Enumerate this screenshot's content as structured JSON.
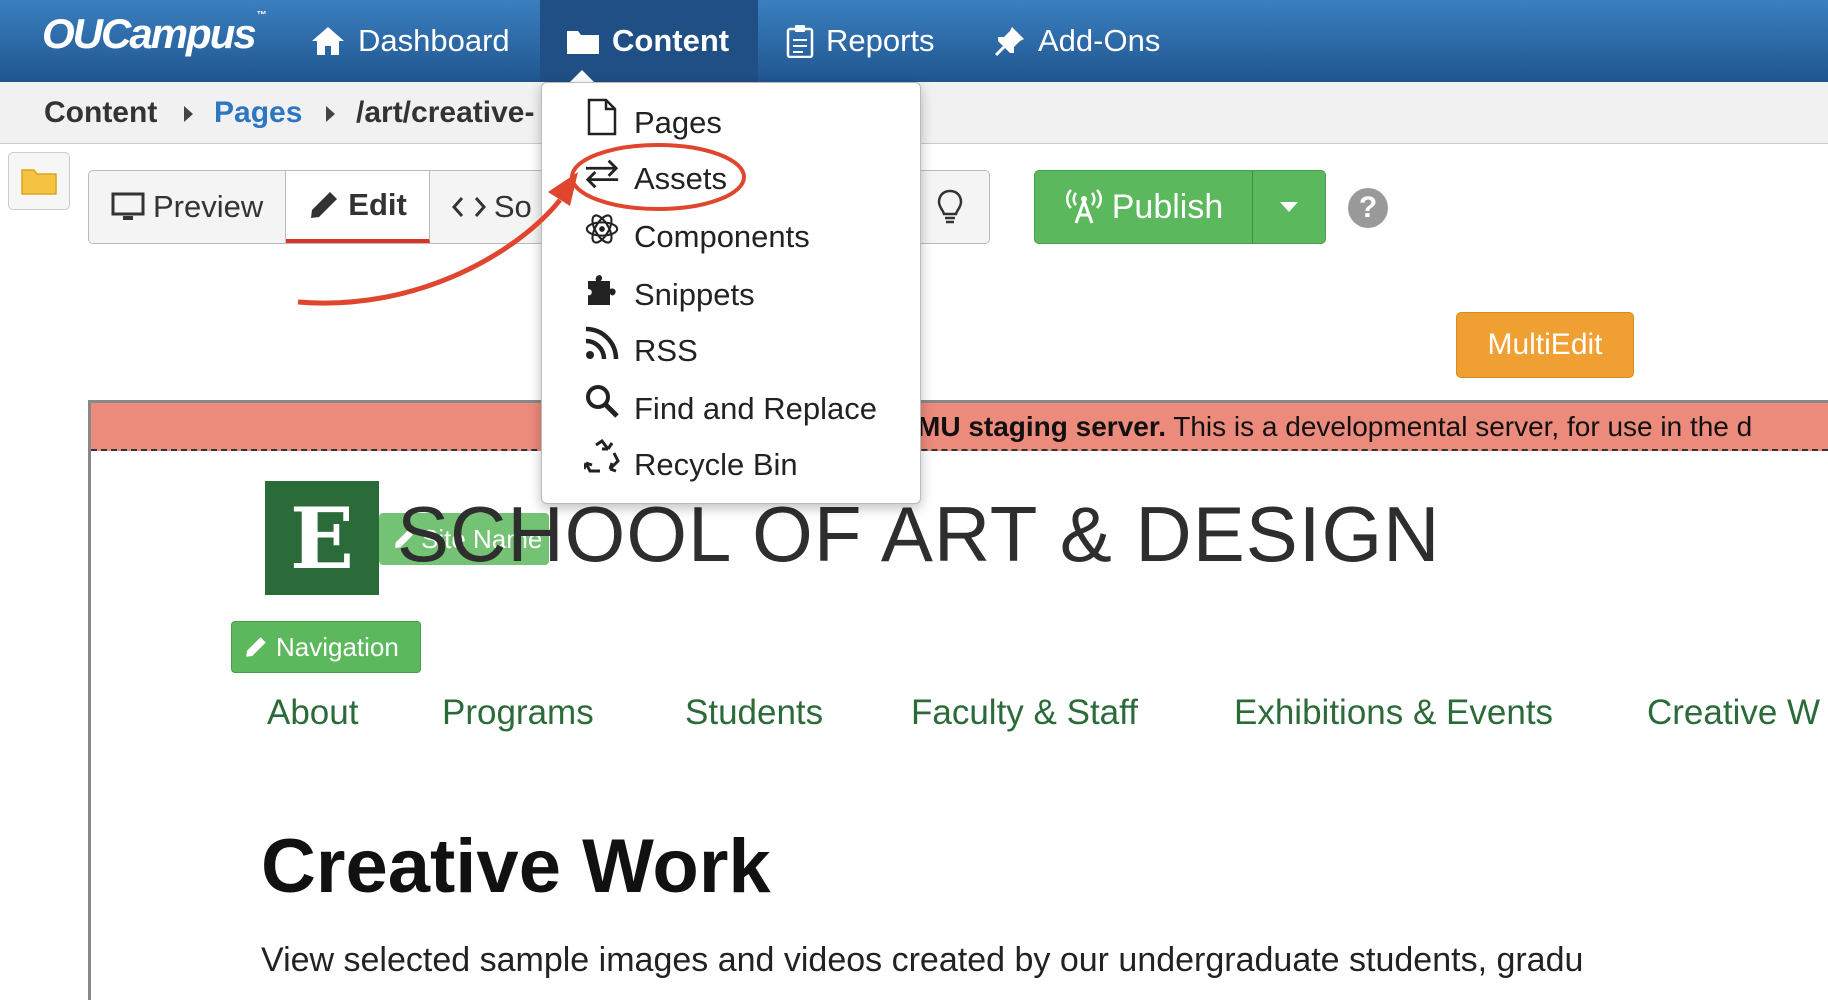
{
  "app": {
    "logo": "OUCampus",
    "logo_tm": "™"
  },
  "topnav": {
    "items": [
      {
        "label": "Dashboard",
        "icon": "home-icon"
      },
      {
        "label": "Content",
        "icon": "folder-icon",
        "active": true
      },
      {
        "label": "Reports",
        "icon": "clipboard-icon"
      },
      {
        "label": "Add-Ons",
        "icon": "pin-icon"
      }
    ]
  },
  "breadcrumb": {
    "items": [
      "Content",
      "Pages",
      "/art/creative-"
    ]
  },
  "toolbar": {
    "preview": "Preview",
    "edit": "Edit",
    "source": "So",
    "publish": "Publish",
    "help": "?",
    "multiedit": "MultiEdit"
  },
  "dropdown": {
    "items": [
      {
        "label": "Pages",
        "icon": "page-icon"
      },
      {
        "label": "Assets",
        "icon": "exchange-icon",
        "highlighted": true
      },
      {
        "label": "Components",
        "icon": "atom-icon"
      },
      {
        "label": "Snippets",
        "icon": "puzzle-icon"
      },
      {
        "label": "RSS",
        "icon": "rss-icon"
      },
      {
        "label": "Find and Replace",
        "icon": "search-icon"
      },
      {
        "label": "Recycle Bin",
        "icon": "recycle-icon"
      }
    ]
  },
  "preview": {
    "staging_bold": "MU staging server.",
    "staging_text": " This is a developmental server, for use in the d",
    "logo_letter": "E",
    "site_name_button": "Site Name",
    "school_title": "SCHOOL OF ART & DESIGN",
    "navigation_button": "Navigation",
    "site_nav": [
      "About",
      "Programs",
      "Students",
      "Faculty & Staff",
      "Exhibitions & Events",
      "Creative W"
    ],
    "page_title": "Creative Work",
    "intro": "View selected sample images and videos created by our undergraduate students, gradu"
  },
  "colors": {
    "topbar": "#2a6aa8",
    "publish": "#5cb85c",
    "multiedit": "#f0a032",
    "staging": "#ec8a7c",
    "brand_green": "#2b6b3a",
    "annotation_red": "#e0452e"
  }
}
